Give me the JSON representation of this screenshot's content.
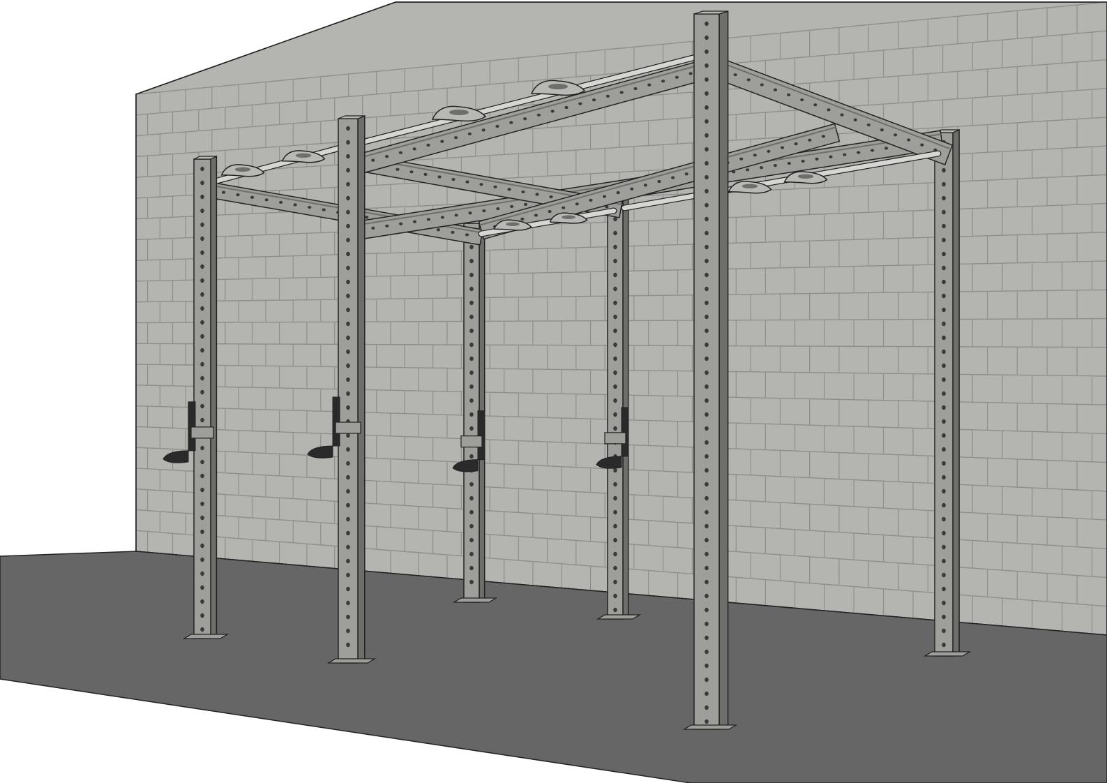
{
  "scene": {
    "subject": "rig",
    "colors": {
      "background": "#ffffff",
      "wall": "#b4b4b0",
      "wall_mortar": "#8e8e8a",
      "floor": "#666666",
      "frame": "#9e9e9a",
      "frame_dark": "#6e6e6a",
      "frame_light": "#b8b8b4",
      "bar": "#d6d6d2",
      "hole": "#3a3a3a",
      "outline": "#222222",
      "j_hook": "#2a2a2a"
    }
  }
}
